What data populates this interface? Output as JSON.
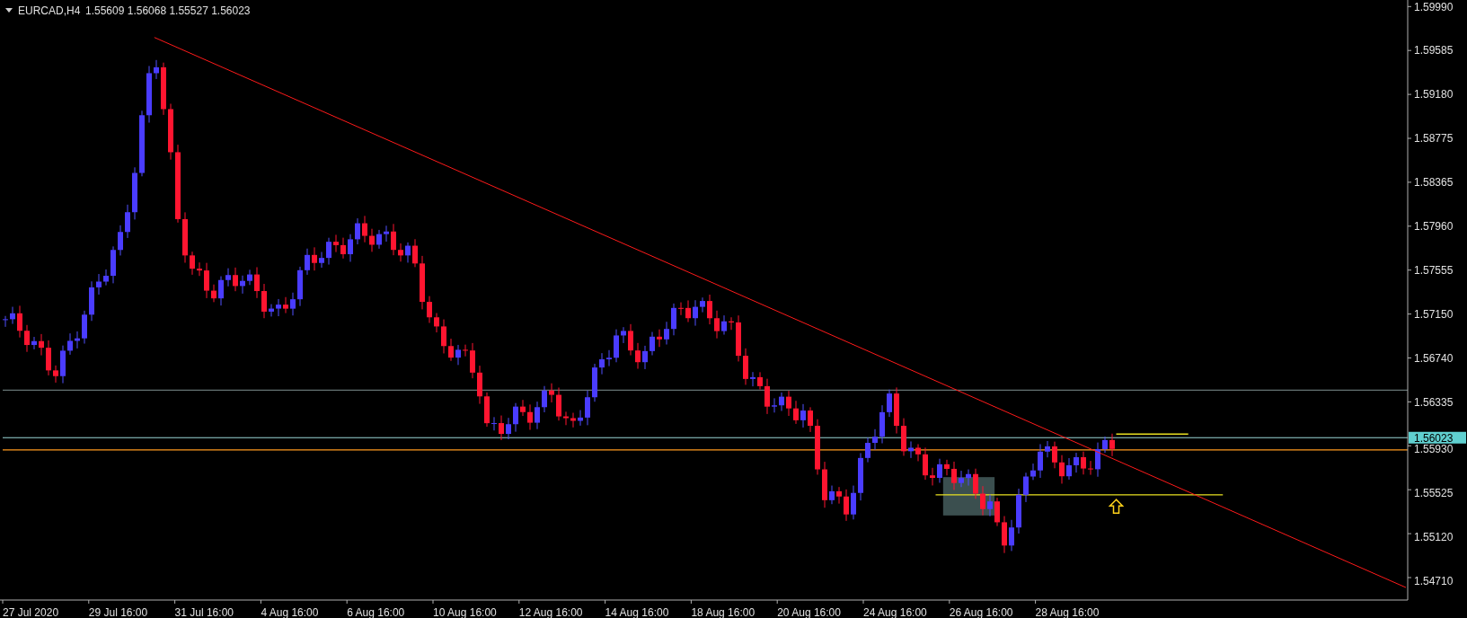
{
  "header": {
    "symbol": "EURCAD,H4",
    "prices": "1.55609 1.56068 1.55527 1.56023"
  },
  "price_axis": [
    "1.59990",
    "1.59585",
    "1.59180",
    "1.58775",
    "1.58365",
    "1.57960",
    "1.57555",
    "1.57150",
    "1.56740",
    "1.56335",
    "1.55930",
    "1.55525",
    "1.55120",
    "1.54710"
  ],
  "current_price": "1.56023",
  "time_axis": [
    "27 Jul 2020",
    "29 Jul 16:00",
    "31 Jul 16:00",
    "4 Aug 16:00",
    "6 Aug 16:00",
    "10 Aug 16:00",
    "12 Aug 16:00",
    "14 Aug 16:00",
    "18 Aug 16:00",
    "20 Aug 16:00",
    "24 Aug 16:00",
    "26 Aug 16:00",
    "28 Aug 16:00"
  ]
}
